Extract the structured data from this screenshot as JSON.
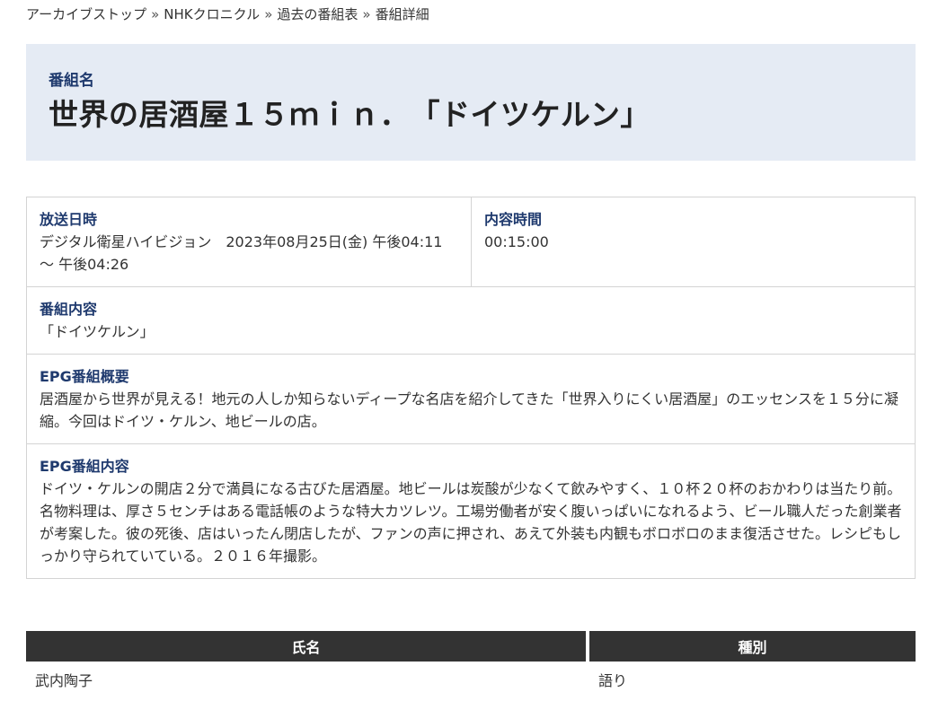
{
  "breadcrumb": [
    {
      "label": "アーカイブストップ"
    },
    {
      "label": "NHKクロニクル"
    },
    {
      "label": "過去の番組表"
    },
    {
      "label": "番組詳細"
    }
  ],
  "breadcrumb_separator": "»",
  "program": {
    "name_label": "番組名",
    "title": "世界の居酒屋１５ｍｉｎ．　「ドイツケルン」"
  },
  "info": {
    "broadcast_label": "放送日時",
    "broadcast_value": "デジタル衛星ハイビジョン　2023年08月25日(金) 午後04:11 ～ 午後04:26",
    "duration_label": "内容時間",
    "duration_value": "00:15:00",
    "content_label": "番組内容",
    "content_value": "「ドイツケルン」",
    "epg_summary_label": "EPG番組概要",
    "epg_summary_value": "居酒屋から世界が見える！地元の人しか知らないディープな名店を紹介してきた「世界入りにくい居酒屋」のエッセンスを１５分に凝縮。今回はドイツ・ケルン、地ビールの店。",
    "epg_detail_label": "EPG番組内容",
    "epg_detail_value": "ドイツ・ケルンの開店２分で満員になる古びた居酒屋。地ビールは炭酸が少なくて飲みやすく、１０杯２０杯のおかわりは当たり前。名物料理は、厚さ５センチはある電話帳のような特大カツレツ。工場労働者が安く腹いっぱいになれるよう、ビール職人だった創業者が考案した。彼の死後、店はいったん閉店したが、ファンの声に押され、あえて外装も内観もボロボロのまま復活させた。レシピもしっかり守られていている。２０１６年撮影。"
  },
  "cast": {
    "headers": {
      "name": "氏名",
      "role": "種別"
    },
    "rows": [
      {
        "name": "武内陶子",
        "role": "語り"
      }
    ]
  },
  "colors": {
    "title_bg": "#e5ebf4",
    "label_blue": "#1f3a6e",
    "table_header_bg": "#333333"
  }
}
